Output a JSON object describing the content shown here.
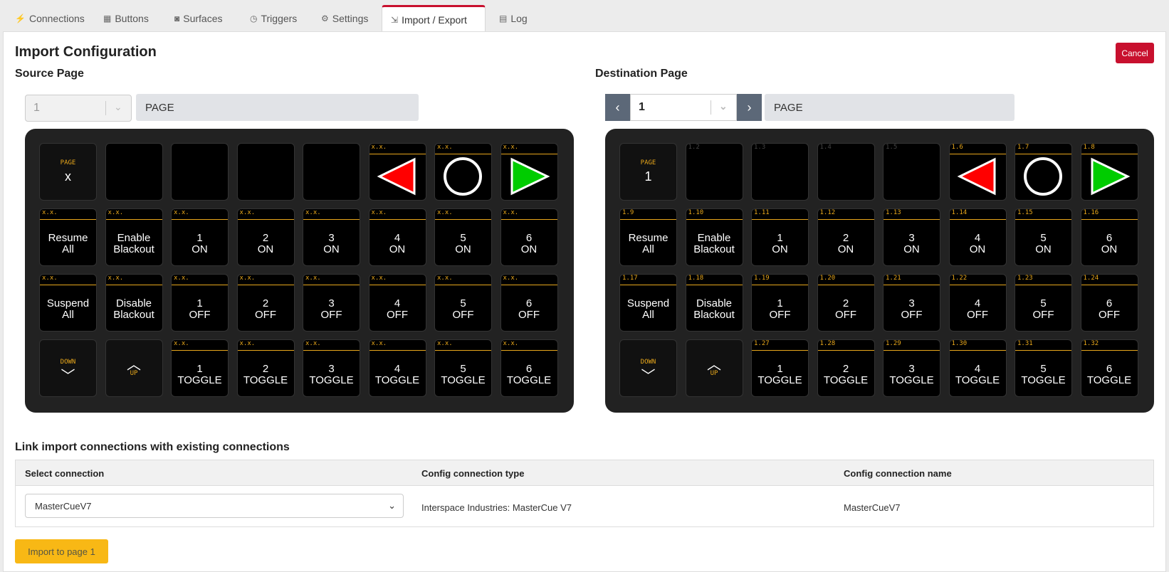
{
  "tabs": [
    {
      "label": "Connections",
      "icon": "plug-icon",
      "glyph": "⚡"
    },
    {
      "label": "Buttons",
      "icon": "calculator-icon",
      "glyph": "▦"
    },
    {
      "label": "Surfaces",
      "icon": "gamepad-icon",
      "glyph": "◙"
    },
    {
      "label": "Triggers",
      "icon": "clock-icon",
      "glyph": "◷"
    },
    {
      "label": "Settings",
      "icon": "gear-icon",
      "glyph": "⚙"
    },
    {
      "label": "Import / Export",
      "icon": "file-import-icon",
      "glyph": "⇲",
      "active": true
    },
    {
      "label": "Log",
      "icon": "clipboard-icon",
      "glyph": "▤"
    }
  ],
  "page_title": "Import Configuration",
  "cancel_label": "Cancel",
  "source": {
    "heading": "Source Page",
    "page_value": "1",
    "page_name": "PAGE",
    "nav_up_label": "PAGE",
    "nav_up_value": "x"
  },
  "destination": {
    "heading": "Destination Page",
    "page_value": "1",
    "page_name": "PAGE",
    "nav_up_label": "PAGE",
    "nav_up_value": "1"
  },
  "button_rows": [
    [
      {
        "type": "pageup"
      },
      {
        "type": "empty",
        "id": "1.2"
      },
      {
        "type": "empty",
        "id": "1.3"
      },
      {
        "type": "empty",
        "id": "1.4"
      },
      {
        "type": "empty",
        "id": "1.5"
      },
      {
        "type": "shape",
        "shape": "triangle-left",
        "id": "1.6"
      },
      {
        "type": "shape",
        "shape": "circle",
        "id": "1.7"
      },
      {
        "type": "shape",
        "shape": "triangle-right",
        "id": "1.8"
      }
    ],
    [
      {
        "type": "text",
        "text": "Resume\nAll",
        "id": "1.9"
      },
      {
        "type": "text",
        "text": "Enable\nBlackout",
        "id": "1.10"
      },
      {
        "type": "text",
        "text": "1\nON",
        "id": "1.11"
      },
      {
        "type": "text",
        "text": "2\nON",
        "id": "1.12"
      },
      {
        "type": "text",
        "text": "3\nON",
        "id": "1.13"
      },
      {
        "type": "text",
        "text": "4\nON",
        "id": "1.14"
      },
      {
        "type": "text",
        "text": "5\nON",
        "id": "1.15"
      },
      {
        "type": "text",
        "text": "6\nON",
        "id": "1.16"
      }
    ],
    [
      {
        "type": "text",
        "text": "Suspend\nAll",
        "id": "1.17"
      },
      {
        "type": "text",
        "text": "Disable\nBlackout",
        "id": "1.18"
      },
      {
        "type": "text",
        "text": "1\nOFF",
        "id": "1.19"
      },
      {
        "type": "text",
        "text": "2\nOFF",
        "id": "1.20"
      },
      {
        "type": "text",
        "text": "3\nOFF",
        "id": "1.21"
      },
      {
        "type": "text",
        "text": "4\nOFF",
        "id": "1.22"
      },
      {
        "type": "text",
        "text": "5\nOFF",
        "id": "1.23"
      },
      {
        "type": "text",
        "text": "6\nOFF",
        "id": "1.24"
      }
    ],
    [
      {
        "type": "pagedown",
        "label": "DOWN"
      },
      {
        "type": "pageupnav",
        "label": "UP"
      },
      {
        "type": "text",
        "text": "1\nTOGGLE",
        "id": "1.27"
      },
      {
        "type": "text",
        "text": "2\nTOGGLE",
        "id": "1.28"
      },
      {
        "type": "text",
        "text": "3\nTOGGLE",
        "id": "1.29"
      },
      {
        "type": "text",
        "text": "4\nTOGGLE",
        "id": "1.30"
      },
      {
        "type": "text",
        "text": "5\nTOGGLE",
        "id": "1.31"
      },
      {
        "type": "text",
        "text": "6\nTOGGLE",
        "id": "1.32"
      }
    ]
  ],
  "source_header_label": "x.x.",
  "link_section": {
    "heading": "Link import connections with existing connections",
    "columns": [
      "Select connection",
      "Config connection type",
      "Config connection name"
    ],
    "rows": [
      {
        "select_value": "MasterCueV7",
        "type": "Interspace Industries: MasterCue V7",
        "name": "MasterCueV7"
      }
    ]
  },
  "import_button_label": "Import to page 1",
  "colors": {
    "accent": "#c8102e",
    "button_header": "#e8a71b",
    "import": "#f8b815",
    "left_arrow": "#ff0000",
    "right_arrow": "#00cc00"
  }
}
